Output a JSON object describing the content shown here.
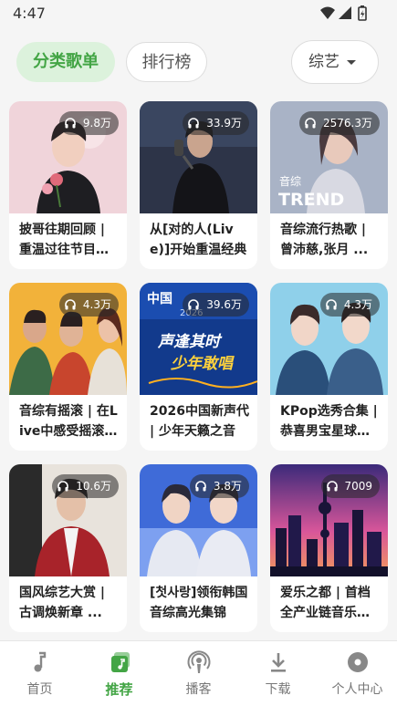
{
  "status": {
    "time": "4:47"
  },
  "filters": {
    "chips": [
      "分类歌单",
      "排行榜"
    ],
    "active": "分类歌单",
    "dropdown": "综艺"
  },
  "playlists": [
    {
      "count": "9.8万",
      "title": "披哥往期回顾 | 重温过往节目精彩"
    },
    {
      "count": "33.9万",
      "title": "从[对的人(Live)]开始重温经典"
    },
    {
      "count": "2576.3万",
      "title": "音综流行热歌 | 曾沛慈,张月 ..."
    },
    {
      "count": "4.3万",
      "title": "音综有摇滚 | 在Live中感受摇滚魅力"
    },
    {
      "count": "39.6万",
      "title": "2026中国新声代 | 少年天籁之音"
    },
    {
      "count": "4.3万",
      "title": "KPop选秀合集 | 恭喜男宝星球出道"
    },
    {
      "count": "10.6万",
      "title": "国风综艺大赏 | 古调焕新章 ..."
    },
    {
      "count": "3.8万",
      "title": "[첫사랑]领衔韩国音综高光集锦"
    },
    {
      "count": "7009",
      "title": "爱乐之都 | 首档全产业链音乐综艺"
    }
  ],
  "covers": {
    "0": {
      "text": ""
    },
    "2": {
      "text": "音综",
      "text2": "TREND"
    },
    "4": {
      "text": "中国",
      "text2": "2026",
      "text3": "声逢其时",
      "text4": "少年敢唱"
    }
  },
  "nav": {
    "items": [
      "首页",
      "推荐",
      "播客",
      "下载",
      "个人中心"
    ],
    "active": "推荐"
  },
  "colors": {
    "accent": "#43a545",
    "chip_bg": "#dcf2dc"
  }
}
